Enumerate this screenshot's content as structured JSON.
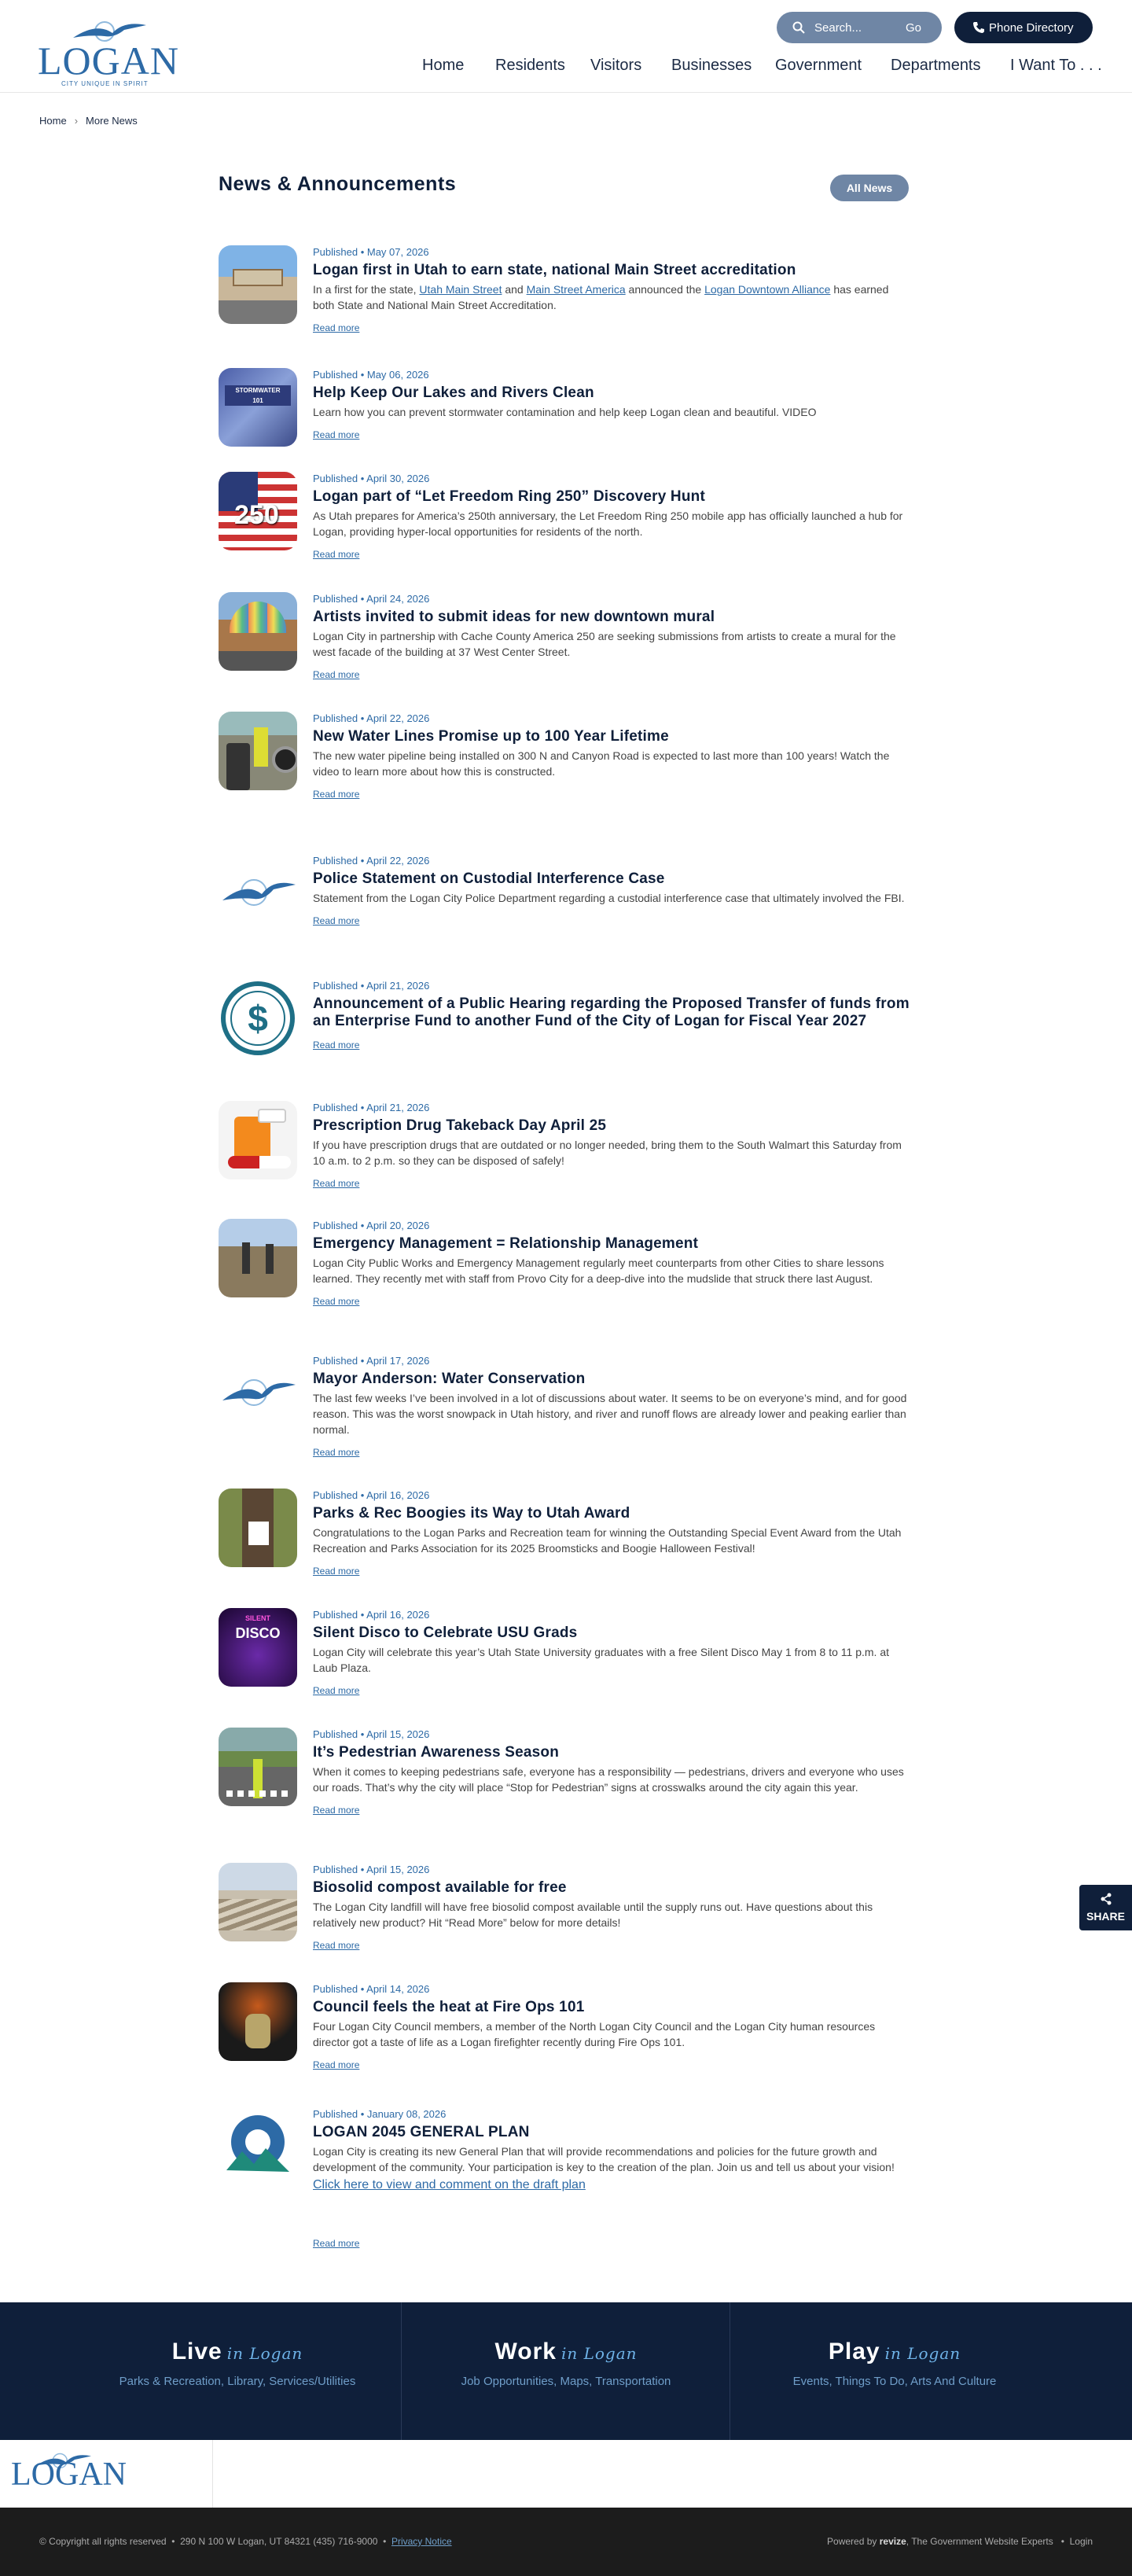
{
  "header": {
    "logo_text": "LOGAN",
    "logo_tagline": "CITY  UNIQUE  IN  SPIRIT",
    "search_placeholder": "Search...",
    "search_go": "Go",
    "phone_label": "Phone Directory",
    "nav": [
      "Home",
      "Residents",
      "Visitors",
      "Businesses",
      "Government",
      "Departments",
      "I Want To . . ."
    ]
  },
  "breadcrumb": {
    "home": "Home",
    "current": "More News"
  },
  "page": {
    "title": "News & Announcements",
    "all_news": "All News",
    "read_more": "Read more"
  },
  "news": [
    {
      "thumb": "photo-street",
      "meta": "Published • May 07, 2026",
      "title": "Logan first in Utah to earn state, national Main Street accreditation",
      "desc_parts": [
        {
          "t": "In a first for the state, "
        },
        {
          "t": "Utah Main Street",
          "link": true
        },
        {
          "t": " and "
        },
        {
          "t": "Main Street America",
          "link": true
        },
        {
          "t": " announced the "
        },
        {
          "t": "Logan Downtown Alliance",
          "link": true
        },
        {
          "t": " has earned both State and National Main Street Accreditation."
        }
      ]
    },
    {
      "thumb": "photo-stormwater",
      "meta": "Published • May 06, 2026",
      "title": "Help Keep Our Lakes and Rivers Clean",
      "desc": "Learn how you can prevent stormwater contamination and help keep Logan clean and beautiful. VIDEO"
    },
    {
      "thumb": "photo-freedom",
      "meta": "Published • April 30, 2026",
      "title": "Logan part of “Let Freedom Ring 250” Discovery Hunt",
      "desc": "As Utah prepares for America’s 250th anniversary, the Let Freedom Ring 250 mobile app has officially launched a hub for Logan, providing hyper-local opportunities for residents of the north."
    },
    {
      "thumb": "photo-mural",
      "meta": "Published • April 24, 2026",
      "title": "Artists invited to submit ideas for new downtown mural",
      "desc": "Logan City in partnership with Cache County America 250 are seeking submissions from artists to create a mural for the west facade of the building at 37 West Center Street."
    },
    {
      "thumb": "photo-pipes",
      "meta": "Published • April 22, 2026",
      "title": "New Water Lines Promise up to 100 Year Lifetime",
      "desc": "The new water pipeline being installed on 300 N and Canyon Road is expected to last more than 100 years! Watch the video to learn more about how this is constructed."
    },
    {
      "thumb": "logo-bird",
      "meta": "Published • April 22, 2026",
      "title": "Police Statement on Custodial Interference Case",
      "desc": "Statement from the Logan City Police Department regarding a custodial interference case that ultimately involved the FBI."
    },
    {
      "thumb": "dollar-icon",
      "meta": "Published • April 21, 2026",
      "title": "Announcement of a Public Hearing regarding the Proposed Transfer of funds from an Enterprise Fund to another Fund of the City of Logan for Fiscal Year 2027",
      "desc": ""
    },
    {
      "thumb": "photo-pills",
      "meta": "Published • April 21, 2026",
      "title": "Prescription Drug Takeback Day April 25",
      "desc": "If you have prescription drugs that are outdated or no longer needed, bring them to the South Walmart this Saturday from 10 a.m. to 2 p.m. so they can be disposed of safely!"
    },
    {
      "thumb": "photo-mudslide",
      "meta": "Published • April 20, 2026",
      "title": "Emergency Management = Relationship Management",
      "desc": "Logan City Public Works and Emergency Management regularly meet counterparts from other Cities to share lessons learned. They recently met with staff from Provo City for a deep-dive into the mudslide that struck there last August."
    },
    {
      "thumb": "logo-bird",
      "meta": "Published • April 17, 2026",
      "title": "Mayor Anderson: Water Conservation",
      "desc": "The last few weeks I’ve been involved in a lot of discussions about water. It seems to be on everyone’s mind, and for good reason. This was the worst snowpack in Utah history, and river and runoff flows are already lower and peaking earlier than normal."
    },
    {
      "thumb": "photo-tree",
      "meta": "Published • April 16, 2026",
      "title": "Parks & Rec Boogies its Way to Utah Award",
      "desc": "Congratulations to the Logan Parks and Recreation team for winning the Outstanding Special Event Award from the Utah Recreation and Parks Association for its 2025 Broomsticks and Boogie Halloween Festival!"
    },
    {
      "thumb": "photo-disco",
      "meta": "Published • April 16, 2026",
      "title": "Silent Disco to Celebrate USU Grads",
      "desc": "Logan City will celebrate this year’s Utah State University graduates with a free Silent Disco May 1 from 8 to 11 p.m. at Laub Plaza."
    },
    {
      "thumb": "photo-crosswalk",
      "meta": "Published • April 15, 2026",
      "title": "It’s Pedestrian Awareness Season",
      "desc": "When it comes to keeping pedestrians safe, everyone has a responsibility — pedestrians, drivers and everyone who uses our roads. That’s why the city will place “Stop for Pedestrian” signs at crosswalks around the city again this year."
    },
    {
      "thumb": "photo-compost",
      "meta": "Published • April 15, 2026",
      "title": "Biosolid compost available for free",
      "desc": "The Logan City landfill will have free biosolid compost available until the supply runs out. Have questions about this relatively new product? Hit “Read More” below for more details!"
    },
    {
      "thumb": "photo-fire",
      "meta": "Published • April 14, 2026",
      "title": "Council feels the heat at Fire Ops 101",
      "desc": "Four Logan City Council members, a member of the North Logan City Council and the Logan City human resources director got a taste of life as a Logan firefighter recently during Fire Ops 101."
    },
    {
      "thumb": "logo-plan",
      "meta": "Published • January 08, 2026",
      "title": "LOGAN 2045 GENERAL PLAN",
      "desc": "Logan City is creating its new General Plan that will provide recommendations and policies for the future growth and development of the community.  Your participation is key to the creation of the plan.  Join us and tell us about your vision!",
      "cta": "Click here to view and comment on the draft plan"
    }
  ],
  "footer": {
    "columns": [
      {
        "head": "Live",
        "script": "in Logan",
        "sub": "Parks & Recreation, Library, Services/Utilities"
      },
      {
        "head": "Work",
        "script": "in Logan",
        "sub": "Job Opportunities, Maps, Transportation"
      },
      {
        "head": "Play",
        "script": "in Logan",
        "sub": "Events, Things To Do, Arts And Culture"
      }
    ],
    "logo_text": "LOGAN",
    "copyright": "© Copyright all rights reserved",
    "address": "290 N 100 W Logan, UT 84321 (435) 716-9000",
    "privacy": "Privacy Notice",
    "powered_prefix": "Powered by",
    "powered_brand": "revize",
    "powered_suffix": ", The Government Website Experts",
    "login": "Login"
  },
  "share": {
    "label": "SHARE"
  },
  "colors": {
    "navy": "#0f1f3a",
    "slate": "#6f86a5",
    "link": "#2d6aa6"
  }
}
